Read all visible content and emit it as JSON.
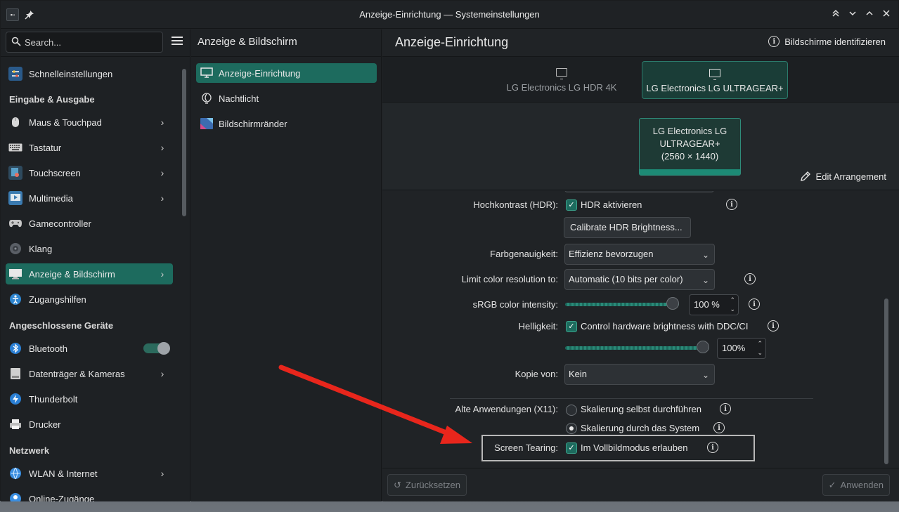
{
  "window": {
    "title": "Anzeige-Einrichtung — Systemeinstellungen"
  },
  "sidebar": {
    "search_placeholder": "Search...",
    "quick": {
      "label": "Schnelleinstellungen",
      "icon": "quick-settings-icon"
    },
    "sections": {
      "input_output": "Eingabe & Ausgabe",
      "devices": "Angeschlossene Geräte",
      "network": "Netzwerk"
    },
    "items": [
      {
        "label": "Maus & Touchpad",
        "icon": "mouse-icon"
      },
      {
        "label": "Tastatur",
        "icon": "keyboard-icon"
      },
      {
        "label": "Touchscreen",
        "icon": "touchscreen-icon"
      },
      {
        "label": "Multimedia",
        "icon": "multimedia-icon"
      },
      {
        "label": "Gamecontroller",
        "icon": "gamepad-icon"
      },
      {
        "label": "Klang",
        "icon": "speaker-icon"
      },
      {
        "label": "Anzeige & Bildschirm",
        "icon": "display-icon"
      },
      {
        "label": "Zugangshilfen",
        "icon": "accessibility-icon"
      },
      {
        "label": "Bluetooth",
        "icon": "bluetooth-icon"
      },
      {
        "label": "Datenträger & Kameras",
        "icon": "drive-icon"
      },
      {
        "label": "Thunderbolt",
        "icon": "thunderbolt-icon"
      },
      {
        "label": "Drucker",
        "icon": "printer-icon"
      },
      {
        "label": "WLAN & Internet",
        "icon": "network-icon"
      },
      {
        "label": "Online-Zugänge",
        "icon": "online-accounts-icon"
      }
    ]
  },
  "middle": {
    "header": "Anzeige & Bildschirm",
    "items": [
      {
        "label": "Anzeige-Einrichtung",
        "icon": "display-config-icon"
      },
      {
        "label": "Nachtlicht",
        "icon": "nightlight-icon"
      },
      {
        "label": "Bildschirmränder",
        "icon": "screen-edges-icon"
      }
    ]
  },
  "main": {
    "title": "Anzeige-Einrichtung",
    "identify_label": "Bildschirme identifizieren",
    "tabs": [
      {
        "label": "LG Electronics LG HDR 4K"
      },
      {
        "label": "LG Electronics LG ULTRAGEAR+"
      }
    ],
    "arrangement": {
      "monitor_line1": "LG Electronics LG",
      "monitor_line2": "ULTRAGEAR+",
      "monitor_line3": "(2560 × 1440)",
      "edit_label": "Edit Arrangement"
    },
    "settings": {
      "hdr_label": "Hochkontrast (HDR):",
      "hdr_check": "HDR aktivieren",
      "calibrate_button": "Calibrate HDR Brightness...",
      "color_accuracy_label": "Farbgenauigkeit:",
      "color_accuracy_value": "Effizienz bevorzugen",
      "limit_color_label": "Limit color resolution to:",
      "limit_color_value": "Automatic  (10 bits per color)",
      "srgb_label": "sRGB color intensity:",
      "srgb_value": "100 %",
      "srgb_level": 1.0,
      "brightness_label": "Helligkeit:",
      "brightness_check": "Control hardware brightness with DDC/CI",
      "brightness_value": "100%",
      "brightness_level": 1.0,
      "copy_label": "Kopie von:",
      "copy_value": "Kein",
      "legacy_label": "Alte Anwendungen (X11):",
      "legacy_option1": "Skalierung selbst durchführen",
      "legacy_option2": "Skalierung durch das System",
      "tearing_label": "Screen Tearing:",
      "tearing_check": "Im Vollbildmodus erlauben"
    },
    "footer": {
      "reset": "Zurücksetzen",
      "apply": "Anwenden"
    }
  },
  "colors": {
    "accent": "#1d6b5e",
    "annotation_arrow": "#e8261c"
  }
}
